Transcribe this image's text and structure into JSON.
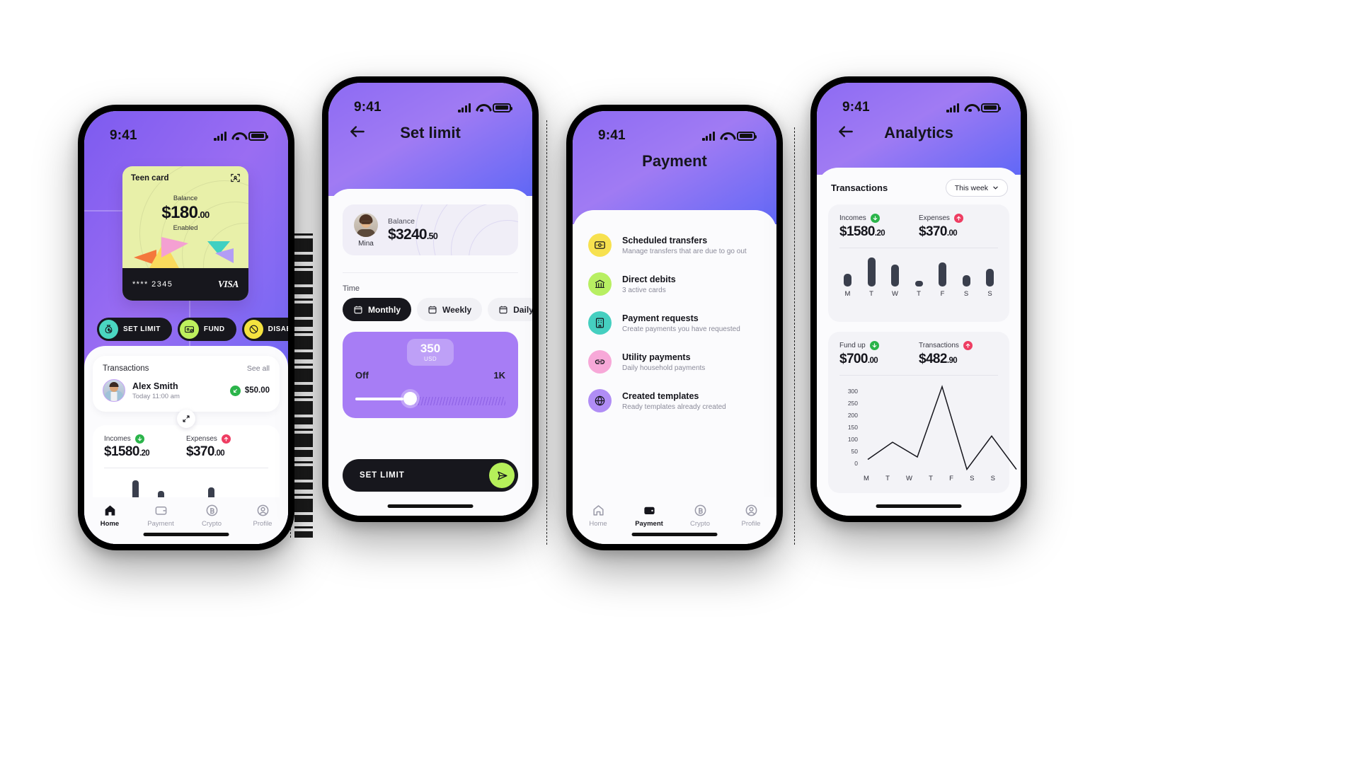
{
  "status_bar": {
    "time": "9:41",
    "signal_icon": "cellular-signal-icon",
    "wifi_icon": "wifi-icon",
    "battery_icon": "battery-icon"
  },
  "phone_home": {
    "card": {
      "title": "Teen card",
      "scan_icon": "scan-face-icon",
      "balance_label": "Balance",
      "balance_main": "$180",
      "balance_cents": ".00",
      "state": "Enabled",
      "number": "**** 2345",
      "brand": "VISA"
    },
    "actions": [
      {
        "label": "SET LIMIT",
        "icon": "money-bag-icon",
        "color": "#4ad6c1"
      },
      {
        "label": "FUND",
        "icon": "card-check-icon",
        "color": "#bdf05d"
      },
      {
        "label": "DISABLE",
        "icon": "disable-icon",
        "color": "#f4e23f"
      }
    ],
    "transactions": {
      "title": "Transactions",
      "see_all": "See all",
      "expand_icon": "expand-arrows-icon",
      "row": {
        "name": "Alex Smith",
        "time": "Today 11:00 am",
        "amount": "$50.00",
        "direction_icon": "arrow-in-icon"
      }
    },
    "stats": {
      "incomes_label": "Incomes",
      "incomes_icon": "arrow-down-circle-icon",
      "incomes_value": "$1580",
      "incomes_cents": ".20",
      "expenses_label": "Expenses",
      "expenses_icon": "arrow-up-circle-icon",
      "expenses_value": "$370",
      "expenses_cents": ".00"
    },
    "tabs": [
      {
        "label": "Home",
        "icon": "home-icon",
        "active": true
      },
      {
        "label": "Payment",
        "icon": "wallet-icon",
        "active": false
      },
      {
        "label": "Crypto",
        "icon": "bitcoin-icon",
        "active": false
      },
      {
        "label": "Profile",
        "icon": "user-circle-icon",
        "active": false
      }
    ]
  },
  "phone_setlimit": {
    "back_icon": "back-arrow-icon",
    "title": "Set limit",
    "balance": {
      "avatar_name": "Mina",
      "label": "Balance",
      "value": "$3240",
      "cents": ".50"
    },
    "time_label": "Time",
    "segments": [
      {
        "label": "Monthly",
        "icon": "calendar-icon",
        "active": true
      },
      {
        "label": "Weekly",
        "icon": "calendar-icon",
        "active": false
      },
      {
        "label": "Daily",
        "icon": "calendar-icon",
        "active": false
      }
    ],
    "slider": {
      "value": "350",
      "currency": "USD",
      "min_label": "Off",
      "max_label": "1K",
      "position_percent": 35
    },
    "cta": {
      "label": "SET LIMIT",
      "icon": "send-icon"
    }
  },
  "phone_payment": {
    "title": "Payment",
    "items": [
      {
        "title": "Scheduled transfers",
        "subtitle": "Manage transfers that are due to go out",
        "icon": "safe-box-icon",
        "color": "#f7e14f"
      },
      {
        "title": "Direct debits",
        "subtitle": "3 active cards",
        "icon": "bank-icon",
        "color": "#b8ef62"
      },
      {
        "title": "Payment requests",
        "subtitle": "Create payments you have requested",
        "icon": "building-icon",
        "color": "#45cfc0"
      },
      {
        "title": "Utility payments",
        "subtitle": "Daily household payments",
        "icon": "link-icon",
        "color": "#f7a8d8"
      },
      {
        "title": "Created templates",
        "subtitle": "Ready templates already created",
        "icon": "globe-icon",
        "color": "#b08df5"
      }
    ],
    "tabs": [
      {
        "label": "Home",
        "icon": "home-icon",
        "active": false
      },
      {
        "label": "Payment",
        "icon": "wallet-icon",
        "active": true
      },
      {
        "label": "Crypto",
        "icon": "bitcoin-icon",
        "active": false
      },
      {
        "label": "Profile",
        "icon": "user-circle-icon",
        "active": false
      }
    ]
  },
  "phone_analytics": {
    "back_icon": "back-arrow-icon",
    "title": "Analytics",
    "section_title": "Transactions",
    "range_chip": {
      "label": "This week",
      "icon": "chevron-down-icon"
    },
    "bar_stats": {
      "left_label": "Incomes",
      "left_icon": "arrow-down-circle-icon",
      "left_value": "$1580",
      "left_cents": ".20",
      "right_label": "Expenses",
      "right_icon": "arrow-up-circle-icon",
      "right_value": "$370",
      "right_cents": ".00"
    },
    "line_stats": {
      "left_label": "Fund up",
      "left_icon": "arrow-down-circle-icon",
      "left_value": "$700",
      "left_cents": ".00",
      "right_label": "Transactions",
      "right_icon": "arrow-up-circle-icon",
      "right_value": "$482",
      "right_cents": ".90"
    }
  },
  "chart_data": [
    {
      "type": "bar",
      "title": "Transactions — this week (bar)",
      "categories": [
        "M",
        "T",
        "W",
        "T",
        "F",
        "S",
        "S"
      ],
      "values": [
        22,
        50,
        38,
        10,
        42,
        20,
        31
      ],
      "xlabel": "",
      "ylabel": "",
      "ylim": [
        0,
        55
      ],
      "grid": false,
      "legend": "none"
    },
    {
      "type": "line",
      "title": "Fund up / Transactions — this week (line)",
      "x": [
        "M",
        "T",
        "W",
        "T",
        "F",
        "S",
        "S"
      ],
      "values": [
        25,
        95,
        35,
        320,
        -15,
        120,
        -15
      ],
      "yticks": [
        0,
        50,
        100,
        150,
        200,
        250,
        300
      ],
      "xlabel": "",
      "ylabel": "",
      "ylim": [
        -25,
        330
      ],
      "grid": false,
      "legend": "none"
    }
  ]
}
